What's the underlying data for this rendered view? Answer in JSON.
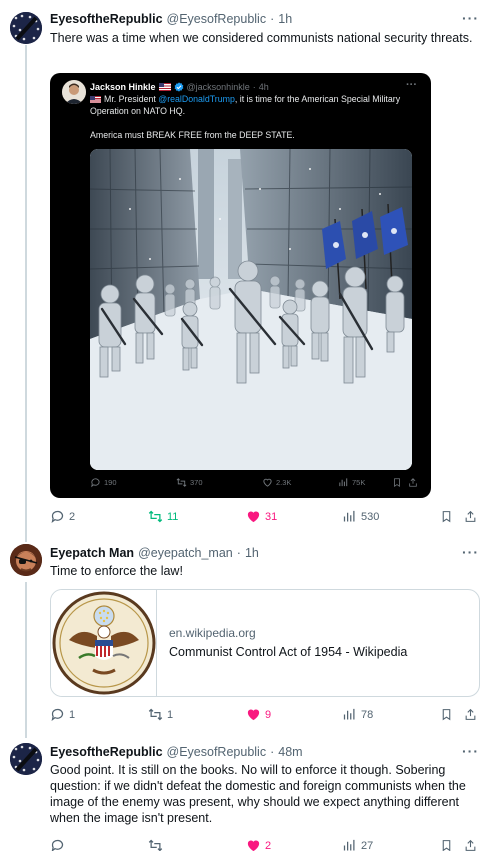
{
  "colors": {
    "text": "#0f1419",
    "secondary": "#536471",
    "retweet_green": "#00ba7c",
    "like_pink": "#f91880",
    "link_blue": "#1d9bf0",
    "border": "#cfd9de"
  },
  "tweets": [
    {
      "name": "EyesoftheRepublic",
      "handle": "@EyesofRepublic",
      "separator": "·",
      "time": "1h",
      "text": "There was a time when we considered communists national security threats.",
      "quote": {
        "name": "Jackson Hinkle",
        "badges": [
          "us-flag-icon",
          "verified-icon"
        ],
        "handle": "@jacksonhinkle",
        "separator": "·",
        "time": "4h",
        "text_prefix": "Mr. President ",
        "mention": "@realDonaldTrump",
        "text_suffix": ", it is time for the American Special Military Operation on NATO HQ.",
        "text2": "America must BREAK FREE from the DEEP STATE.",
        "stats": {
          "replies": "190",
          "retweets": "370",
          "likes": "2.3K",
          "views": "75K"
        }
      },
      "stats": {
        "replies": "2",
        "retweets": "11",
        "likes": "31",
        "views": "530"
      }
    },
    {
      "name": "Eyepatch Man",
      "handle": "@eyepatch_man",
      "separator": "·",
      "time": "1h",
      "text": "Time to enforce the law!",
      "card": {
        "domain": "en.wikipedia.org",
        "title": "Communist Control Act of 1954 - Wikipedia"
      },
      "stats": {
        "replies": "1",
        "retweets": "1",
        "likes": "9",
        "views": "78"
      }
    },
    {
      "name": "EyesoftheRepublic",
      "handle": "@EyesofRepublic",
      "separator": "·",
      "time": "48m",
      "text": "Good point. It is still on the books. No will to enforce it though. Sobering question: if we didn't defeat the domestic and foreign communists when the image of the enemy was present, why should we expect anything different when the image isn't present.",
      "stats": {
        "replies": "",
        "retweets": "",
        "likes": "2",
        "views": "27"
      }
    }
  ],
  "more_label": "···"
}
